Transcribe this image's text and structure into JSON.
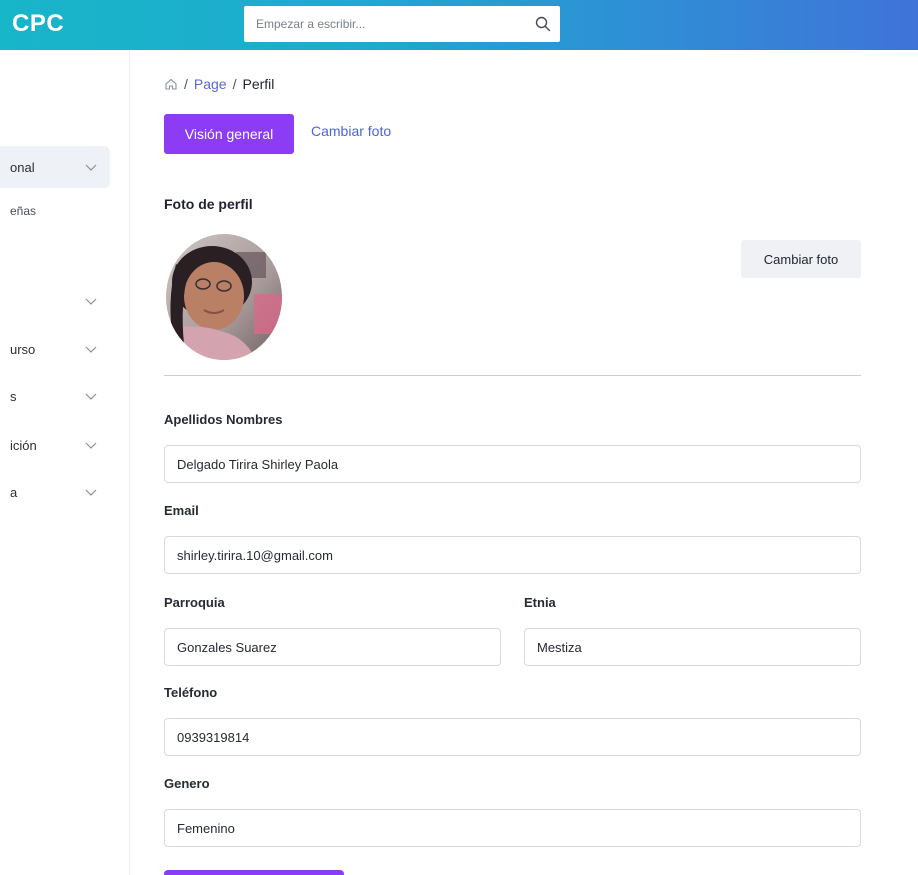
{
  "header": {
    "brand": "CPC",
    "search_placeholder": "Empezar a escribir..."
  },
  "sidebar": {
    "items": [
      {
        "label": "onal",
        "active": true
      },
      {
        "label": "",
        "active": false
      },
      {
        "label": "urso",
        "active": false
      },
      {
        "label": "s",
        "active": false
      },
      {
        "label": "ición",
        "active": false
      },
      {
        "label": "a",
        "active": false
      }
    ],
    "sub_item": "eñas"
  },
  "breadcrumb": {
    "home_icon": "home-icon",
    "page": "Page",
    "current": "Perfil"
  },
  "tabs": {
    "overview": "Visión general",
    "change_photo": "Cambiar foto"
  },
  "profile": {
    "photo_title": "Foto de perfil",
    "change_photo_button": "Cambiar foto"
  },
  "form": {
    "name_label": "Apellidos Nombres",
    "name_value": "Delgado Tirira Shirley Paola",
    "email_label": "Email",
    "email_value": "shirley.tirira.10@gmail.com",
    "parish_label": "Parroquia",
    "parish_value": "Gonzales Suarez",
    "ethnicity_label": "Etnia",
    "ethnicity_value": "Mestiza",
    "phone_label": "Teléfono",
    "phone_value": "0939319814",
    "gender_label": "Genero",
    "gender_value": "Femenino"
  },
  "colors": {
    "accent": "#8c3cf5",
    "link": "#4a66d8",
    "header_start": "#18b6c9",
    "header_end": "#3f73d8"
  }
}
